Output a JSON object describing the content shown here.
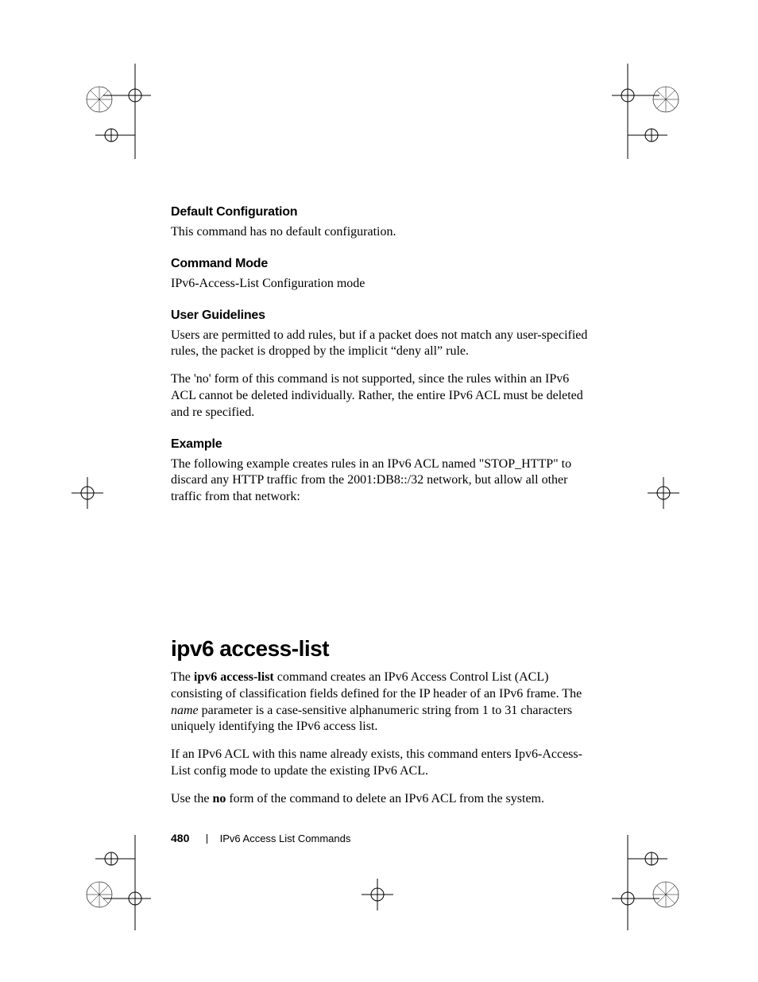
{
  "sections": {
    "defaultConfig": {
      "heading": "Default Configuration",
      "body": "This command has no default configuration."
    },
    "commandMode": {
      "heading": "Command Mode",
      "body": "IPv6-Access-List Configuration mode"
    },
    "userGuidelines": {
      "heading": "User Guidelines",
      "p1": "Users are permitted to add rules, but if a packet does not match any user-specified rules, the packet is dropped by the implicit “deny all” rule.",
      "p2": "The 'no' form of this command is not supported, since the rules within an IPv6 ACL cannot be deleted individually. Rather, the entire IPv6 ACL must be deleted and re specified."
    },
    "example": {
      "heading": "Example",
      "body": "The following example creates rules in an IPv6 ACL named \"STOP_HTTP\" to discard any HTTP traffic from the 2001:DB8::/32 network, but allow all other traffic from that network:"
    },
    "ipv6AccessList": {
      "title": "ipv6 access-list",
      "p1_a": "The ",
      "p1_b": "ipv6 access-list",
      "p1_c": " command creates an IPv6 Access Control List (ACL) consisting of classification fields defined for the IP header of an IPv6 frame. The ",
      "p1_d": "name",
      "p1_e": " parameter is a case-sensitive alphanumeric string from 1 to 31 characters uniquely identifying the IPv6 access list.",
      "p2": "If an IPv6 ACL with this name already exists, this command enters Ipv6-Access-List config mode to update the existing IPv6 ACL.",
      "p3_a": "Use the ",
      "p3_b": "no",
      "p3_c": " form of the command to delete an IPv6 ACL from the system."
    }
  },
  "footer": {
    "pageNumber": "480",
    "chapter": "IPv6 Access List Commands"
  }
}
